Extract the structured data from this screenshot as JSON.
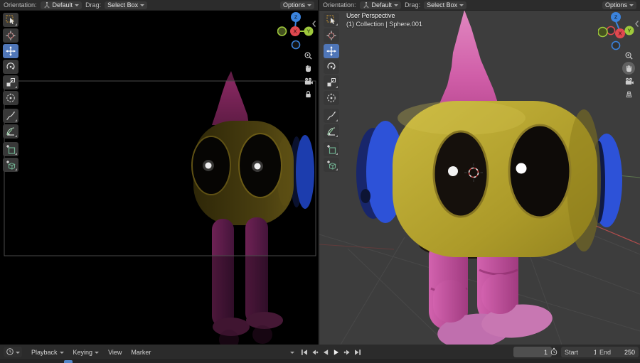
{
  "viewport_header": {
    "orientation_label": "Orientation:",
    "orientation_value": "Default",
    "drag_label": "Drag:",
    "drag_value": "Select Box",
    "options_label": "Options"
  },
  "view_info": {
    "line1": "User Perspective",
    "line2": "(1) Collection | Sphere.001"
  },
  "toolbar": {
    "tools": [
      {
        "name": "select-box",
        "icon": "select-box",
        "active": false,
        "has_sub": true
      },
      {
        "name": "cursor",
        "icon": "cursor",
        "active": false,
        "has_sub": false
      },
      {
        "name": "move",
        "icon": "move",
        "active": true,
        "has_sub": false
      },
      {
        "name": "rotate",
        "icon": "rotate",
        "active": false,
        "has_sub": false
      },
      {
        "name": "scale",
        "icon": "scale",
        "active": false,
        "has_sub": true
      },
      {
        "name": "transform",
        "icon": "transform",
        "active": false,
        "has_sub": false
      },
      {
        "name": "annotate",
        "icon": "annotate",
        "active": false,
        "has_sub": true
      },
      {
        "name": "measure",
        "icon": "measure",
        "active": false,
        "has_sub": true
      },
      {
        "name": "add-primitive",
        "icon": "add-square",
        "active": false,
        "has_sub": true
      },
      {
        "name": "add-cube",
        "icon": "add-cube",
        "active": false,
        "has_sub": true
      }
    ]
  },
  "nav": {
    "left_viewport": [
      {
        "name": "zoom",
        "icon": "zoom",
        "active": false
      },
      {
        "name": "pan",
        "icon": "pan",
        "active": false
      },
      {
        "name": "toggle-camera-view",
        "icon": "camera-view",
        "active": false
      },
      {
        "name": "lock-camera-to-view",
        "icon": "camera-lock",
        "active": false
      }
    ],
    "right_viewport": [
      {
        "name": "zoom",
        "icon": "zoom",
        "active": false
      },
      {
        "name": "pan",
        "icon": "pan",
        "active": true
      },
      {
        "name": "toggle-camera-view",
        "icon": "camera-view",
        "active": false
      },
      {
        "name": "toggle-orthographic",
        "icon": "grid-ortho",
        "active": false
      }
    ]
  },
  "gizmo": {
    "axis_labels": {
      "x": "X",
      "y": "Y",
      "z": "Z"
    }
  },
  "timeline": {
    "menus": [
      {
        "label": "Playback",
        "dropdown": true
      },
      {
        "label": "Keying",
        "dropdown": true
      },
      {
        "label": "View",
        "dropdown": false
      },
      {
        "label": "Marker",
        "dropdown": false
      }
    ],
    "transport": [
      "jump-start",
      "prev-keyframe",
      "play-reverse",
      "play",
      "next-keyframe",
      "jump-end"
    ],
    "current_frame": "1",
    "start_label": "Start",
    "start_value": "1",
    "end_label": "End",
    "end_value": "250",
    "playhead_frame": "1"
  },
  "colors": {
    "active_tool_blue": "#4f76b8",
    "axis_x_red": "#e0484f",
    "axis_y_green": "#9fc93c",
    "axis_z_blue": "#3b83dd",
    "viewport_bg": "#3d3d3d",
    "camera_view_bg": "#000000",
    "header_bg": "#2c2c2c",
    "character_head_yellow": "#b7a52f",
    "character_spike_pink": "#d05ea8",
    "character_ear_blue": "#2d52d8",
    "character_leg_pink": "#c2439c",
    "playhead_blue": "#5285c7"
  }
}
